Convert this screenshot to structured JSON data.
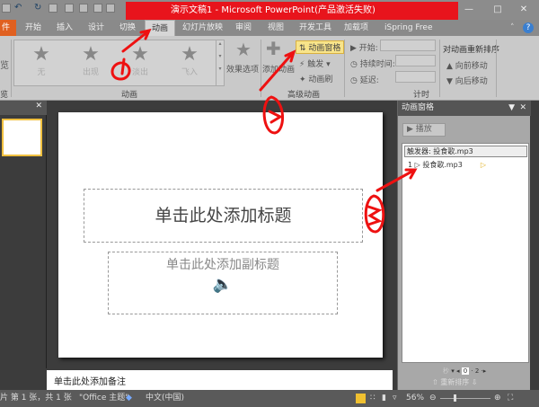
{
  "window": {
    "title": "演示文稿1 - Microsoft PowerPoint(产品激活失败)",
    "minimize": "—",
    "maximize": "□",
    "close": "✕"
  },
  "tabs": {
    "file": "件",
    "items": [
      "开始",
      "插入",
      "设计",
      "切换",
      "动画",
      "幻灯片放映",
      "审阅",
      "视图",
      "开发工具",
      "加载项",
      "iSpring Free"
    ],
    "active": "动画"
  },
  "ribbon": {
    "preview_group": {
      "button": "览",
      "label": "览"
    },
    "animation_group": {
      "label": "动画",
      "items": [
        "无",
        "出现",
        "淡出",
        "飞入"
      ],
      "effect_options": "效果选项"
    },
    "advanced_group": {
      "label": "高级动画",
      "add_animation": "添加动画",
      "animation_pane": "动画窗格",
      "trigger": "触发",
      "painter": "动画刷"
    },
    "timing_group": {
      "label": "计时",
      "start": "开始:",
      "duration": "持续时间:",
      "delay": "延迟:"
    },
    "reorder_group": {
      "title": "对动画重新排序",
      "forward": "向前移动",
      "backward": "向后移动"
    }
  },
  "slide": {
    "title_placeholder": "单击此处添加标题",
    "subtitle_placeholder": "单击此处添加副标题"
  },
  "notes": {
    "placeholder": "单击此处添加备注"
  },
  "animation_pane": {
    "title": "动画窗格",
    "play": "播放",
    "trigger": "触发器: 投食歌.mp3",
    "item_number": "1",
    "item_name": "投食歌.mp3",
    "seconds_label": "秒",
    "timeline": [
      "0",
      "2"
    ],
    "reorder": "重新排序"
  },
  "statusbar": {
    "slide": "片 第 1 张，共 1 张",
    "theme": "\"Office 主题\"",
    "language": "中文(中国)",
    "zoom": "56%"
  },
  "annotations": [
    "1",
    "2",
    "3"
  ],
  "colors": {
    "title_red": "#e8141c",
    "annotation_red": "#ee1111"
  }
}
